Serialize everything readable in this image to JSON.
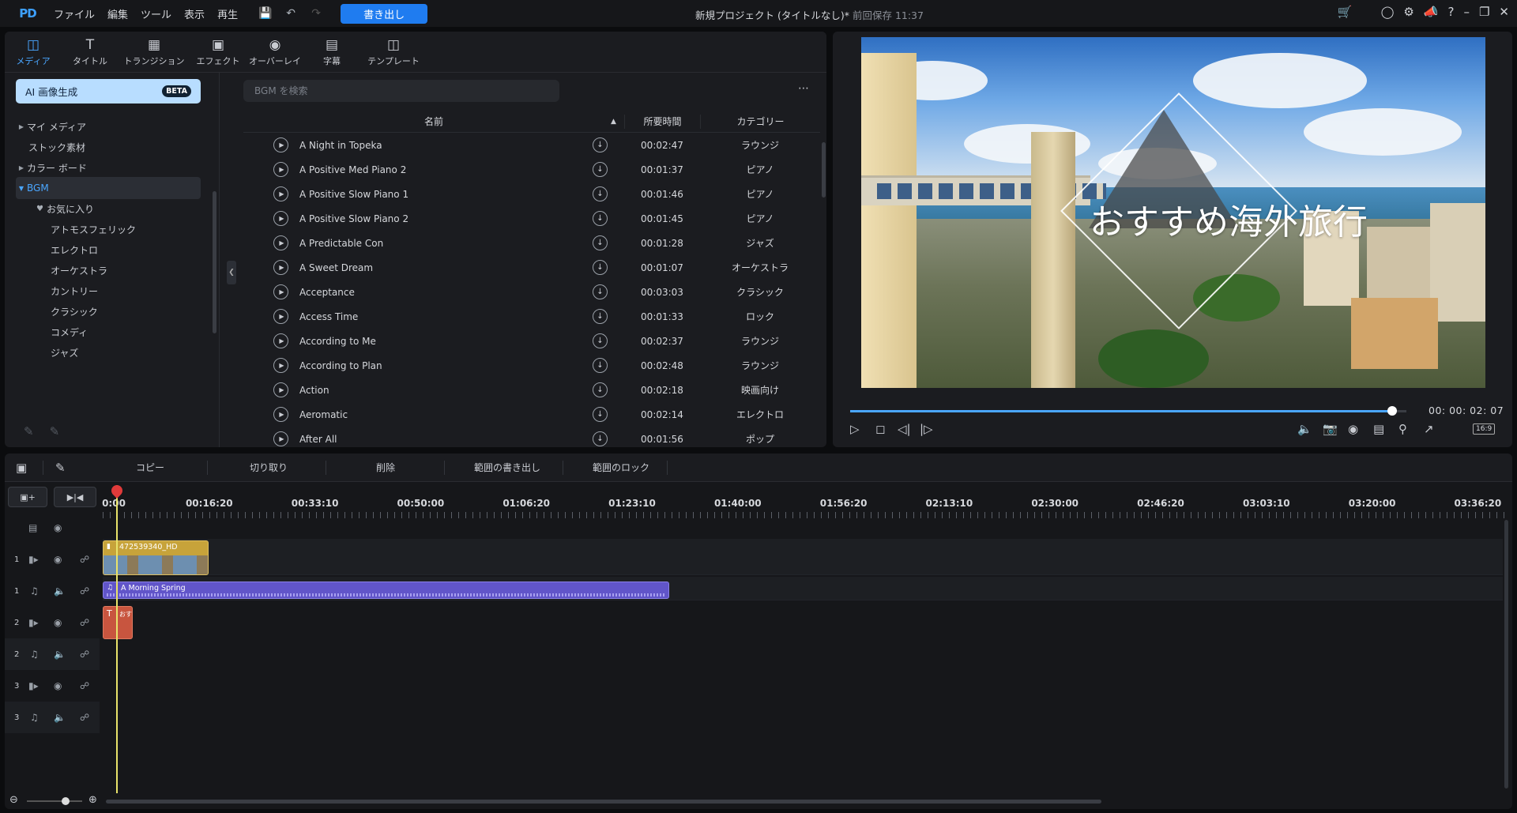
{
  "menubar": {
    "logo": "PD",
    "items": [
      "ファイル",
      "編集",
      "ツール",
      "表示",
      "再生"
    ],
    "export_label": "書き出し",
    "doc_title": "新規プロジェクト (タイトルなし)*",
    "saved": "前回保存 11:37"
  },
  "tabs": [
    {
      "label": "メディア",
      "icon": "media-icon"
    },
    {
      "label": "タイトル",
      "icon": "title-icon"
    },
    {
      "label": "トランジション",
      "icon": "transition-icon"
    },
    {
      "label": "エフェクト",
      "icon": "effect-icon"
    },
    {
      "label": "オーバーレイ",
      "icon": "overlay-icon"
    },
    {
      "label": "字幕",
      "icon": "subtitle-icon"
    },
    {
      "label": "テンプレート",
      "icon": "template-icon"
    }
  ],
  "sidebar": {
    "ai_label": "AI 画像生成",
    "beta": "BETA",
    "items": [
      "マイ メディア",
      "ストック素材",
      "カラー ボード",
      "BGM",
      "お気に入り",
      "アトモスフェリック",
      "エレクトロ",
      "オーケストラ",
      "カントリー",
      "クラシック",
      "コメディ",
      "ジャズ"
    ]
  },
  "search": {
    "placeholder": "BGM を検索"
  },
  "table": {
    "col_name": "名前",
    "col_duration": "所要時間",
    "col_category": "カテゴリー",
    "rows": [
      {
        "name": "A Night in Topeka",
        "duration": "00:02:47",
        "category": "ラウンジ"
      },
      {
        "name": "A Positive Med Piano 2",
        "duration": "00:01:37",
        "category": "ピアノ"
      },
      {
        "name": "A Positive Slow Piano 1",
        "duration": "00:01:46",
        "category": "ピアノ"
      },
      {
        "name": "A Positive Slow Piano 2",
        "duration": "00:01:45",
        "category": "ピアノ"
      },
      {
        "name": "A Predictable Con",
        "duration": "00:01:28",
        "category": "ジャズ"
      },
      {
        "name": "A Sweet Dream",
        "duration": "00:01:07",
        "category": "オーケストラ"
      },
      {
        "name": "Acceptance",
        "duration": "00:03:03",
        "category": "クラシック"
      },
      {
        "name": "Access Time",
        "duration": "00:01:33",
        "category": "ロック"
      },
      {
        "name": "According to Me",
        "duration": "00:02:37",
        "category": "ラウンジ"
      },
      {
        "name": "According to Plan",
        "duration": "00:02:48",
        "category": "ラウンジ"
      },
      {
        "name": "Action",
        "duration": "00:02:18",
        "category": "映画向け"
      },
      {
        "name": "Aeromatic",
        "duration": "00:02:14",
        "category": "エレクトロ"
      },
      {
        "name": "After All",
        "duration": "00:01:56",
        "category": "ポップ"
      }
    ]
  },
  "preview": {
    "overlay_title": "おすすめ海外旅行",
    "timecode": "00: 00: 02: 07",
    "progress": 0.975,
    "ratio": "16:9"
  },
  "timeline": {
    "tools": [
      "コピー",
      "切り取り",
      "削除",
      "範囲の書き出し",
      "範囲のロック"
    ],
    "ruler": [
      "0:00",
      "00:16:20",
      "00:33:10",
      "00:50:00",
      "01:06:20",
      "01:23:10",
      "01:40:00",
      "01:56:20",
      "02:13:10",
      "02:30:00",
      "02:46:20",
      "03:03:10",
      "03:20:00",
      "03:36:20"
    ],
    "video_clip": "472539340_HD",
    "audio_clip": "A Morning Spring",
    "title_clip": "おす",
    "track_numbers": [
      "1",
      "1",
      "2",
      "2",
      "3",
      "3"
    ]
  }
}
